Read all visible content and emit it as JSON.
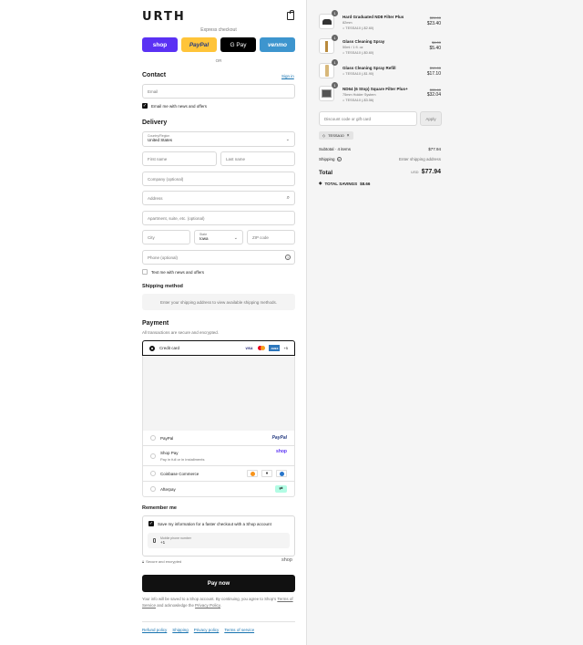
{
  "brand": {
    "logo": "URTH"
  },
  "express": {
    "label": "Express checkout",
    "or": "OR",
    "buttons": [
      {
        "label": "shop"
      },
      {
        "label": "PayPal"
      },
      {
        "label": "G Pay"
      },
      {
        "label": "venmo"
      }
    ]
  },
  "contact": {
    "heading": "Contact",
    "sign_in": "Sign in",
    "email_placeholder": "Email",
    "news_label": "Email me with news and offers"
  },
  "delivery": {
    "heading": "Delivery",
    "country_label": "Country/Region",
    "country_value": "United States",
    "first_name": "First name",
    "last_name": "Last name",
    "company": "Company (optional)",
    "address": "Address",
    "apartment": "Apartment, suite, etc. (optional)",
    "city": "City",
    "state_label": "State",
    "state_value": "Iowa",
    "zip": "ZIP code",
    "phone": "Phone (optional)",
    "text_label": "Text me with news and offers"
  },
  "shipping": {
    "heading": "Shipping method",
    "notice": "Enter your shipping address to view available shipping methods."
  },
  "payment": {
    "heading": "Payment",
    "subtitle": "All transactions are secure and encrypted.",
    "credit_card": "Credit card",
    "more_cards": "+5",
    "card_logos": [
      "VISA",
      "MC",
      "AMEX"
    ],
    "paypal": "PayPal",
    "paypal_logo": "PayPal",
    "shop_pay": "Shop Pay",
    "shop_pay_sub": "Pay in full or in installments",
    "shop_logo": "shop",
    "coinbase": "Coinbase Commerce",
    "afterpay": "Afterpay"
  },
  "remember": {
    "heading": "Remember me",
    "save_label": "Save my information for a faster checkout with a Shop account",
    "phone_label": "Mobile phone number",
    "phone_value": "+1",
    "secure": "Secure and encrypted",
    "shop_logo": "shop"
  },
  "pay_now": "Pay now",
  "legal": {
    "line1": "Your info will be saved to a Shop account. By continuing, you agree to Shop’s",
    "terms": "Terms of Service",
    "and_ack": "and acknowledge the",
    "privacy": "Privacy Policy",
    "period": "."
  },
  "footer": [
    "Refund policy",
    "Shipping",
    "Privacy policy",
    "Terms of service"
  ],
  "cart": {
    "items": [
      {
        "qty": "1",
        "name": "Hard Graduated ND8 Filter Plus",
        "variant": "82mm",
        "discount": "TESSA10 (-$2.60)",
        "old": "$26.00",
        "price": "$23.40"
      },
      {
        "qty": "1",
        "name": "Glass Cleaning Spray",
        "variant": "50ml / 1 fl. oz",
        "discount": "TESSA10 (-$0.60)",
        "old": "$6.00",
        "price": "$5.40"
      },
      {
        "qty": "1",
        "name": "Glass Cleaning Spray Refill",
        "variant": "",
        "discount": "TESSA10 (-$1.90)",
        "old": "$19.00",
        "price": "$17.10"
      },
      {
        "qty": "1",
        "name": "ND64 (6 Stop) Square Filter Plus+",
        "variant": "75mm Holder System",
        "discount": "TESSA10 (-$3.56)",
        "old": "$35.60",
        "price": "$32.04"
      }
    ],
    "discount_placeholder": "Discount code or gift card",
    "apply": "Apply",
    "applied_code": "TESSA10",
    "subtotal_label": "Subtotal · 4 items",
    "subtotal": "$77.94",
    "shipping_label": "Shipping",
    "shipping_value": "Enter shipping address",
    "total_label": "Total",
    "currency": "USD",
    "total": "$77.94",
    "savings_label": "TOTAL SAVINGS",
    "savings": "$8.66"
  }
}
